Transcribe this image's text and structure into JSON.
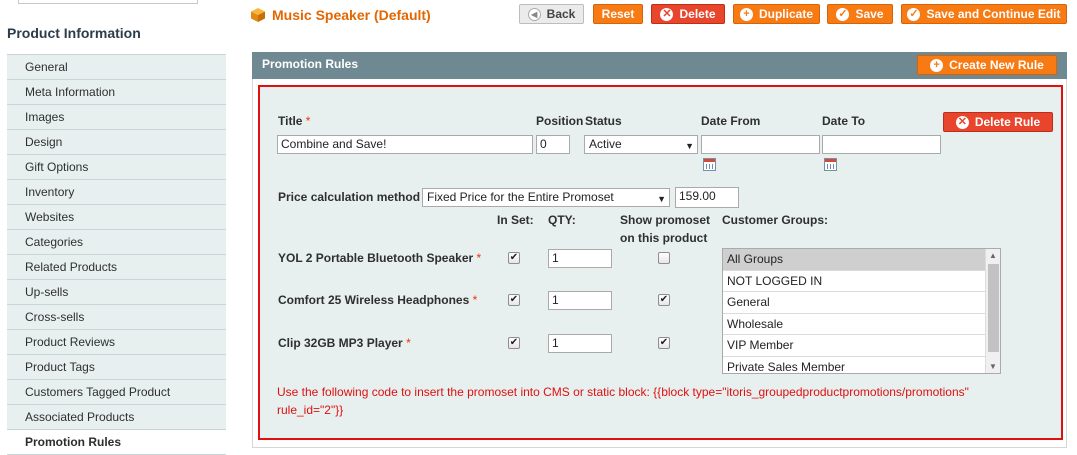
{
  "sidebar": {
    "title": "Product Information",
    "items": [
      {
        "label": "General"
      },
      {
        "label": "Meta Information"
      },
      {
        "label": "Images"
      },
      {
        "label": "Design"
      },
      {
        "label": "Gift Options"
      },
      {
        "label": "Inventory"
      },
      {
        "label": "Websites"
      },
      {
        "label": "Categories"
      },
      {
        "label": "Related Products"
      },
      {
        "label": "Up-sells"
      },
      {
        "label": "Cross-sells"
      },
      {
        "label": "Product Reviews"
      },
      {
        "label": "Product Tags"
      },
      {
        "label": "Customers Tagged Product"
      },
      {
        "label": "Associated Products"
      },
      {
        "label": "Promotion Rules"
      }
    ],
    "active": "Promotion Rules"
  },
  "header": {
    "title": "Music Speaker (Default)",
    "buttons": {
      "back": "Back",
      "reset": "Reset",
      "delete": "Delete",
      "duplicate": "Duplicate",
      "save": "Save",
      "save_continue": "Save and Continue Edit"
    }
  },
  "panel": {
    "title": "Promotion Rules",
    "create_button": "Create New Rule"
  },
  "rule": {
    "labels": {
      "title": "Title",
      "position": "Position",
      "status": "Status",
      "date_from": "Date From",
      "date_to": "Date To",
      "price_method": "Price calculation method",
      "in_set": "In Set:",
      "qty": "QTY:",
      "show_promoset_1": "Show promoset",
      "show_promoset_2": "on this product",
      "customer_groups": "Customer Groups:"
    },
    "required_mark": "*",
    "delete_button": "Delete Rule",
    "title_value": "Combine and Save!",
    "position_value": "0",
    "status_value": "Active",
    "date_from_value": "",
    "date_to_value": "",
    "price_method_value": "Fixed Price for the Entire Promoset",
    "price_value": "159.00",
    "products": [
      {
        "name": "YOL 2 Portable Bluetooth Speaker",
        "in_set": true,
        "qty": "1",
        "show": false
      },
      {
        "name": "Comfort 25 Wireless Headphones",
        "in_set": true,
        "qty": "1",
        "show": true
      },
      {
        "name": "Clip 32GB MP3 Player",
        "in_set": true,
        "qty": "1",
        "show": true
      }
    ],
    "customer_groups": [
      "All Groups",
      "NOT LOGGED IN",
      "General",
      "Wholesale",
      "VIP Member",
      "Private Sales Member"
    ],
    "selected_group": "All Groups",
    "note_line1": "Use the following code to insert the promoset into CMS or static block: {{block type=\"itoris_groupedproductpromotions/promotions\"",
    "note_line2": "rule_id=\"2\"}}"
  },
  "colors": {
    "accent": "#f77a13",
    "delete": "#e9442c",
    "panel_header": "#6f8992",
    "highlight_border": "#e01010",
    "title": "#e26703"
  }
}
